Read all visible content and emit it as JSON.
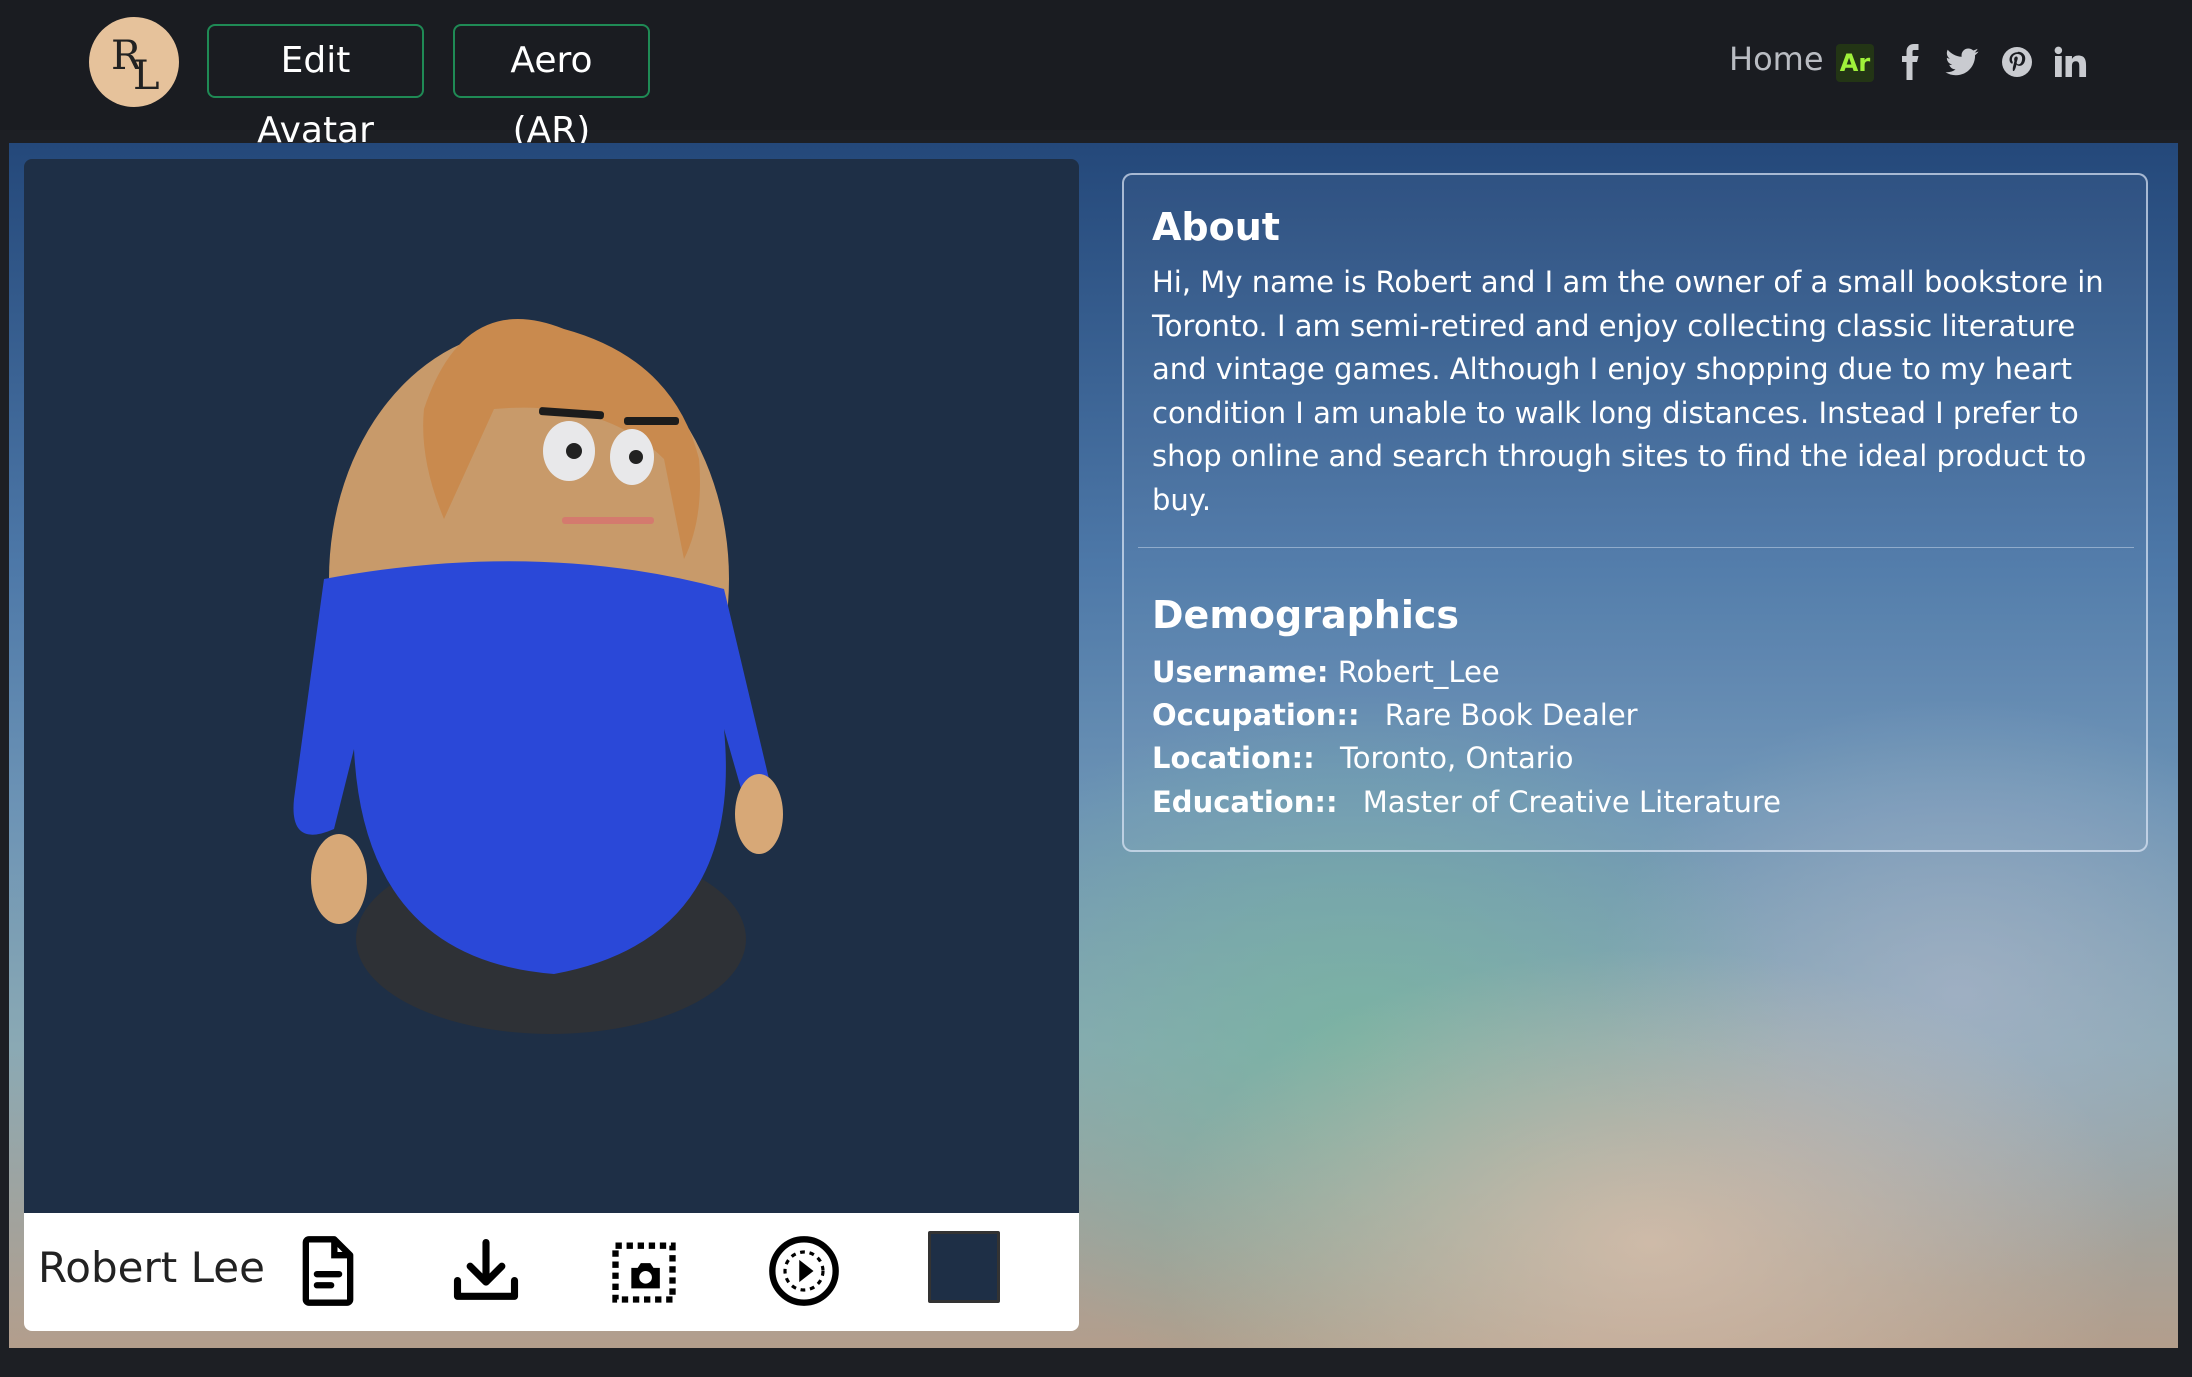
{
  "header": {
    "logo_initial_1": "R",
    "logo_initial_2": "L",
    "edit_avatar_label": "Edit Avatar",
    "aero_label": "Aero (AR)",
    "home_label": "Home",
    "ar_badge": "Ar",
    "social_icons": [
      "facebook-icon",
      "twitter-icon",
      "pinterest-icon",
      "linkedin-icon"
    ]
  },
  "avatar": {
    "name": "Robert Lee",
    "background_color": "#1e2f46",
    "tools": [
      "document-icon",
      "download-icon",
      "screenshot-icon",
      "play-icon",
      "color-swatch"
    ]
  },
  "about": {
    "title": "About",
    "text": "Hi, My name is Robert and I am the owner of a small bookstore in Toronto. I am semi-retired and enjoy collecting classic literature and vintage games. Although I enjoy shopping due to my heart condition I am unable to walk long distances. Instead I prefer to shop online and search through sites to find the ideal product to buy."
  },
  "demographics": {
    "title": "Demographics",
    "username_label": "Username:",
    "username": "Robert_Lee",
    "occupation_label": "Occupation::",
    "occupation": "Rare Book Dealer",
    "location_label": "Location::",
    "location": "Toronto, Ontario",
    "education_label": "Education::",
    "education": "Master of Creative Literature"
  },
  "colors": {
    "accent_border": "#1f8a55",
    "ar_badge_text": "#9ff13a",
    "panel_bg": "#1e2f46"
  }
}
